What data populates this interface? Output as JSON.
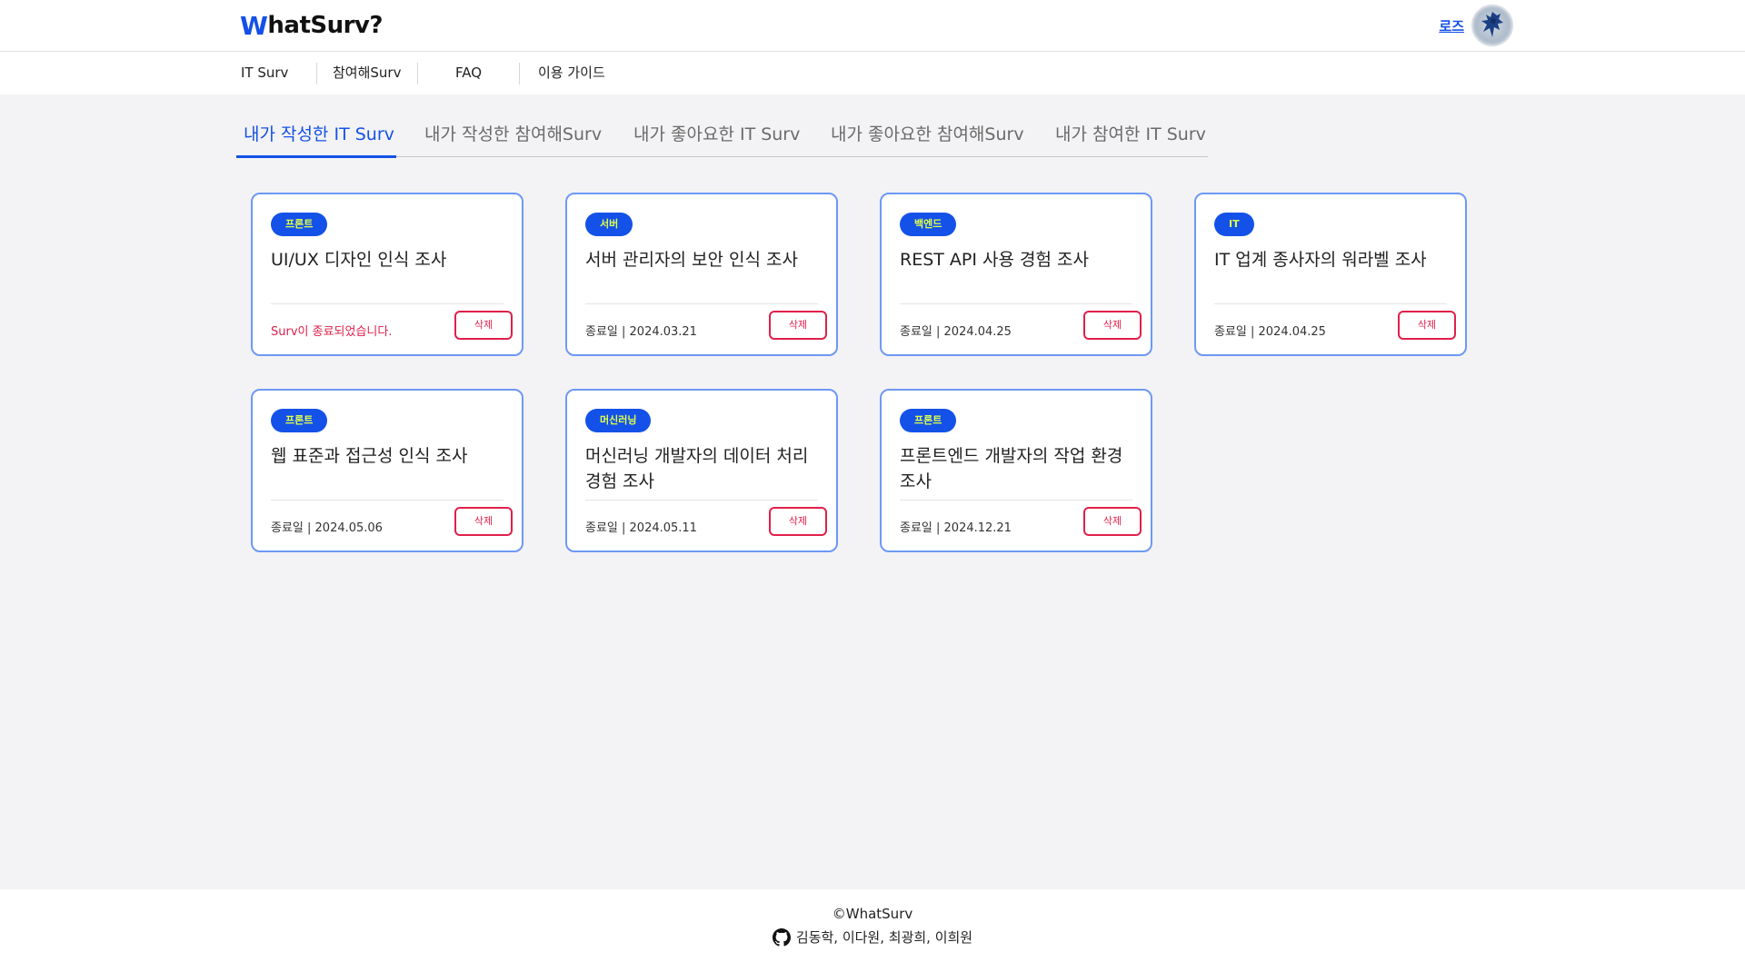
{
  "header": {
    "logo_w": "W",
    "logo_rest": "hatSurv?",
    "user_name": "로즈"
  },
  "nav": {
    "items": [
      "IT Surv",
      "참여해Surv",
      "FAQ",
      "이용 가이드"
    ]
  },
  "tabs": [
    {
      "label": "내가 작성한 IT Surv",
      "active": true
    },
    {
      "label": "내가 작성한 참여해Surv",
      "active": false
    },
    {
      "label": "내가 좋아요한 IT Surv",
      "active": false
    },
    {
      "label": "내가 좋아요한 참여해Surv",
      "active": false
    },
    {
      "label": "내가 참여한 IT Surv",
      "active": false
    }
  ],
  "cards": [
    {
      "badge": "프론트",
      "title": "UI/UX 디자인 인식 조사",
      "date": "Surv이 종료되었습니다.",
      "ended": true,
      "delete_label": "삭제"
    },
    {
      "badge": "서버",
      "title": "서버 관리자의 보안 인식 조사",
      "date": "종료일 | 2024.03.21",
      "ended": false,
      "delete_label": "삭제"
    },
    {
      "badge": "백엔드",
      "title": "REST API 사용 경험 조사",
      "date": "종료일 | 2024.04.25",
      "ended": false,
      "delete_label": "삭제"
    },
    {
      "badge": "IT",
      "title": "IT 업계 종사자의 워라벨 조사",
      "date": "종료일 | 2024.04.25",
      "ended": false,
      "delete_label": "삭제"
    },
    {
      "badge": "프론트",
      "title": "웹 표준과 접근성 인식 조사",
      "date": "종료일 | 2024.05.06",
      "ended": false,
      "delete_label": "삭제"
    },
    {
      "badge": "머신러닝",
      "title": "머신러닝 개발자의 데이터 처리 경험 조사",
      "date": "종료일 | 2024.05.11",
      "ended": false,
      "delete_label": "삭제"
    },
    {
      "badge": "프론트",
      "title": "프론트엔드 개발자의 작업 환경 조사",
      "date": "종료일 | 2024.12.21",
      "ended": false,
      "delete_label": "삭제"
    }
  ],
  "footer": {
    "copyright": "©WhatSurv",
    "members": "김동학, 이다원, 최광희, 이희원",
    "github_icon": "github-icon"
  },
  "colors": {
    "accent": "#1451e8",
    "badge_text": "#dfff4a",
    "danger": "#e0204a",
    "card_border": "#6e98f5",
    "page_bg": "#f3f3f5"
  }
}
